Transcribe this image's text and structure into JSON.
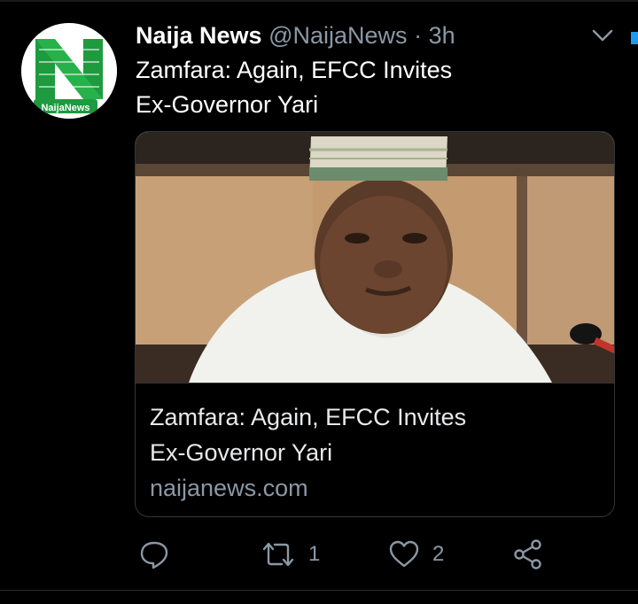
{
  "tweet": {
    "author": {
      "display_name": "Naija News",
      "handle": "@NaijaNews",
      "avatar_text": "NaijaNews"
    },
    "separator": "·",
    "time": "3h",
    "text_line1": "Zamfara: Again, EFCC Invites",
    "text_line2": "Ex-Governor Yari",
    "card": {
      "title_line1": "Zamfara: Again, EFCC Invites",
      "title_line2": "Ex-Governor Yari",
      "domain": "naijanews.com"
    },
    "actions": {
      "reply_icon": "reply-icon",
      "retweet_icon": "retweet-icon",
      "retweet_count": "1",
      "like_icon": "heart-icon",
      "like_count": "2",
      "share_icon": "share-icon"
    }
  },
  "colors": {
    "background": "#000000",
    "text_primary": "#ffffff",
    "text_secondary": "#8b98a5",
    "card_border": "#333639",
    "brand_green": "#1e9a3f",
    "accent_blue": "#1d9bf0"
  }
}
